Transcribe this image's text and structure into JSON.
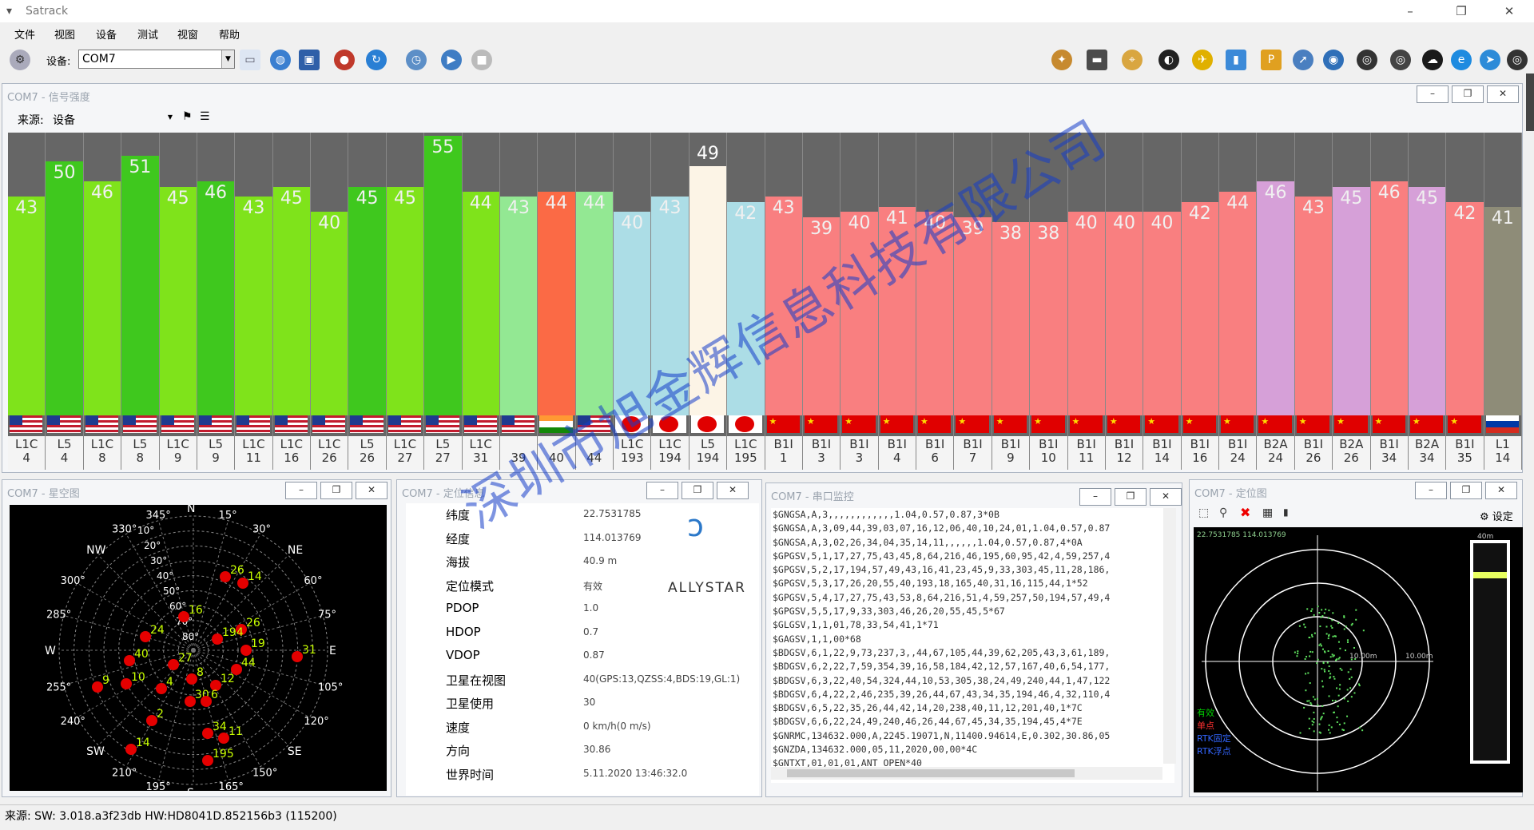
{
  "app": {
    "title": "Satrack",
    "min_label": "–",
    "max_label": "❐",
    "close_label": "✕"
  },
  "menu": [
    "文件",
    "视图",
    "设备",
    "测试",
    "视窗",
    "帮助"
  ],
  "toolbar": {
    "device_label": "设备:",
    "device_value": "COM7"
  },
  "signal_window": {
    "title": "COM7 - 信号强度",
    "source_label": "来源:",
    "source_value": "设备"
  },
  "signal_bars": [
    {
      "cn0": 43,
      "label": "L1C",
      "prn": "4",
      "flag": "us",
      "color": "#7fe31b"
    },
    {
      "cn0": 50,
      "label": "L5",
      "prn": "4",
      "flag": "us",
      "color": "#3fc81e"
    },
    {
      "cn0": 46,
      "label": "L1C",
      "prn": "8",
      "flag": "us",
      "color": "#7fe31b"
    },
    {
      "cn0": 51,
      "label": "L5",
      "prn": "8",
      "flag": "us",
      "color": "#3fc81e"
    },
    {
      "cn0": 45,
      "label": "L1C",
      "prn": "9",
      "flag": "us",
      "color": "#7fe31b"
    },
    {
      "cn0": 46,
      "label": "L5",
      "prn": "9",
      "flag": "us",
      "color": "#3fc81e"
    },
    {
      "cn0": 43,
      "label": "L1C",
      "prn": "11",
      "flag": "us",
      "color": "#7fe31b"
    },
    {
      "cn0": 45,
      "label": "L1C",
      "prn": "16",
      "flag": "us",
      "color": "#7fe31b"
    },
    {
      "cn0": 40,
      "label": "L1C",
      "prn": "26",
      "flag": "us",
      "color": "#7fe31b"
    },
    {
      "cn0": 45,
      "label": "L5",
      "prn": "26",
      "flag": "us",
      "color": "#3fc81e"
    },
    {
      "cn0": 45,
      "label": "L1C",
      "prn": "27",
      "flag": "us",
      "color": "#7fe31b"
    },
    {
      "cn0": 55,
      "label": "L5",
      "prn": "27",
      "flag": "us",
      "color": "#3fc81e"
    },
    {
      "cn0": 44,
      "label": "L1C",
      "prn": "31",
      "flag": "us",
      "color": "#7fe31b"
    },
    {
      "cn0": 43,
      "label": "",
      "prn": "39",
      "flag": "us",
      "color": "#93e893"
    },
    {
      "cn0": 44,
      "label": "",
      "prn": "40",
      "flag": "in",
      "color": "#fb6a45"
    },
    {
      "cn0": 44,
      "label": "",
      "prn": "44",
      "flag": "us",
      "color": "#93e893"
    },
    {
      "cn0": 40,
      "label": "L1C",
      "prn": "193",
      "flag": "jp",
      "color": "#acdde6"
    },
    {
      "cn0": 43,
      "label": "L1C",
      "prn": "194",
      "flag": "jp",
      "color": "#acdde6"
    },
    {
      "cn0": 49,
      "label": "L5",
      "prn": "194",
      "flag": "jp",
      "color": "#fcf4e6"
    },
    {
      "cn0": 42,
      "label": "L1C",
      "prn": "195",
      "flag": "jp",
      "color": "#acdde6"
    },
    {
      "cn0": 43,
      "label": "B1I",
      "prn": "1",
      "flag": "cn",
      "color": "#f97f80"
    },
    {
      "cn0": 39,
      "label": "B1I",
      "prn": "3",
      "flag": "cn",
      "color": "#f97f80"
    },
    {
      "cn0": 40,
      "label": "B1I",
      "prn": "3",
      "flag": "cn",
      "color": "#f97f80"
    },
    {
      "cn0": 41,
      "label": "B1I",
      "prn": "4",
      "flag": "cn",
      "color": "#f97f80"
    },
    {
      "cn0": 40,
      "label": "B1I",
      "prn": "6",
      "flag": "cn",
      "color": "#f97f80"
    },
    {
      "cn0": 39,
      "label": "B1I",
      "prn": "7",
      "flag": "cn",
      "color": "#f97f80"
    },
    {
      "cn0": 38,
      "label": "B1I",
      "prn": "9",
      "flag": "cn",
      "color": "#f97f80"
    },
    {
      "cn0": 38,
      "label": "B1I",
      "prn": "10",
      "flag": "cn",
      "color": "#f97f80"
    },
    {
      "cn0": 40,
      "label": "B1I",
      "prn": "11",
      "flag": "cn",
      "color": "#f97f80"
    },
    {
      "cn0": 40,
      "label": "B1I",
      "prn": "12",
      "flag": "cn",
      "color": "#f97f80"
    },
    {
      "cn0": 40,
      "label": "B1I",
      "prn": "14",
      "flag": "cn",
      "color": "#f97f80"
    },
    {
      "cn0": 42,
      "label": "B1I",
      "prn": "16",
      "flag": "cn",
      "color": "#f97f80"
    },
    {
      "cn0": 44,
      "label": "B1I",
      "prn": "24",
      "flag": "cn",
      "color": "#f97f80"
    },
    {
      "cn0": 46,
      "label": "B2A",
      "prn": "24",
      "flag": "cn",
      "color": "#d6a0d8"
    },
    {
      "cn0": 43,
      "label": "B1I",
      "prn": "26",
      "flag": "cn",
      "color": "#f97f80"
    },
    {
      "cn0": 45,
      "label": "B2A",
      "prn": "26",
      "flag": "cn",
      "color": "#d6a0d8"
    },
    {
      "cn0": 46,
      "label": "B1I",
      "prn": "34",
      "flag": "cn",
      "color": "#f97f80"
    },
    {
      "cn0": 45,
      "label": "B2A",
      "prn": "34",
      "flag": "cn",
      "color": "#d6a0d8"
    },
    {
      "cn0": 42,
      "label": "B1I",
      "prn": "35",
      "flag": "cn",
      "color": "#f97f80"
    },
    {
      "cn0": 41,
      "label": "L1",
      "prn": "14",
      "flag": "ru",
      "color": "#8e8c78"
    }
  ],
  "sky_window": {
    "title": "COM7 - 星空图",
    "directions": [
      "N",
      "NE",
      "E",
      "SE",
      "S",
      "SW",
      "W",
      "NW"
    ],
    "azimuths": [
      "15°",
      "30°",
      "60°",
      "75°",
      "105°",
      "120°",
      "150°",
      "165°",
      "195°",
      "210°",
      "240°",
      "255°",
      "285°",
      "300°",
      "330°",
      "345°"
    ],
    "elevations": [
      "10°",
      "20°",
      "30°",
      "40°",
      "50°",
      "60°",
      "70°",
      "80°"
    ],
    "sats": [
      "26",
      "14",
      "16",
      "26",
      "194",
      "19",
      "44",
      "31",
      "4",
      "40",
      "10",
      "9",
      "24",
      "27",
      "8",
      "12",
      "30",
      "6",
      "2",
      "34",
      "11",
      "14",
      "195"
    ]
  },
  "pos_window": {
    "title": "COM7 - 定位信息",
    "brand": "ALLYSTAR",
    "rows": [
      {
        "label": "纬度",
        "value": "22.7531785"
      },
      {
        "label": "经度",
        "value": "114.013769"
      },
      {
        "label": "海拔",
        "value": "40.9 m"
      },
      {
        "label": "定位模式",
        "value": "有效"
      },
      {
        "label": "PDOP",
        "value": "1.0"
      },
      {
        "label": "HDOP",
        "value": "0.7"
      },
      {
        "label": "VDOP",
        "value": "0.87"
      },
      {
        "label": "卫星在视图",
        "value": "40(GPS:13,QZSS:4,BDS:19,GL:1)"
      },
      {
        "label": "卫星使用",
        "value": "30"
      },
      {
        "label": "速度",
        "value": "0 km/h(0 m/s)"
      },
      {
        "label": "方向",
        "value": "30.86"
      },
      {
        "label": "世界时间",
        "value": "5.11.2020 13:46:32.0"
      }
    ]
  },
  "serial_window": {
    "title": "COM7 - 串口监控",
    "lines": [
      "$GNGSA,A,3,,,,,,,,,,,,1.04,0.57,0.87,3*0B",
      "$GNGSA,A,3,09,44,39,03,07,16,12,06,40,10,24,01,1.04,0.57,0.87",
      "$GNGSA,A,3,02,26,34,04,35,14,11,,,,,,1.04,0.57,0.87,4*0A",
      "$GPGSV,5,1,17,27,75,43,45,8,64,216,46,195,60,95,42,4,59,257,4",
      "$GPGSV,5,2,17,194,57,49,43,16,41,23,45,9,33,303,45,11,28,186,",
      "$GPGSV,5,3,17,26,20,55,40,193,18,165,40,31,16,115,44,1*52",
      "$GPGSV,5,4,17,27,75,43,53,8,64,216,51,4,59,257,50,194,57,49,4",
      "$GPGSV,5,5,17,9,33,303,46,26,20,55,45,5*67",
      "$GLGSV,1,1,01,78,33,54,41,1*71",
      "$GAGSV,1,1,00*68",
      "$BDGSV,6,1,22,9,73,237,3,,44,67,105,44,39,62,205,43,3,61,189,",
      "$BDGSV,6,2,22,7,59,354,39,16,58,184,42,12,57,167,40,6,54,177,",
      "$BDGSV,6,3,22,40,54,324,44,10,53,305,38,24,49,240,44,1,47,122",
      "$BDGSV,6,4,22,2,46,235,39,26,44,67,43,34,35,194,46,4,32,110,4",
      "$BDGSV,6,5,22,35,26,44,42,14,20,238,40,11,12,201,40,1*7C",
      "$BDGSV,6,6,22,24,49,240,46,26,44,67,45,34,35,194,45,4*7E",
      "$GNRMC,134632.000,A,2245.19071,N,11400.94614,E,0.302,30.86,05",
      "$GNZDA,134632.000,05,11,2020,00,00*4C",
      "$GNTXT,01,01,01,ANT_OPEN*40"
    ]
  },
  "map_window": {
    "title": "COM7 - 定位图",
    "settings_label": "设定",
    "scale_labels": [
      "40m",
      "10.00m",
      "10.00m"
    ],
    "coord_text": "22.7531785 114.013769",
    "legend": [
      "有效",
      "单点",
      "RTK固定",
      "RTK浮点"
    ],
    "legend_colors": [
      "#00d000",
      "#ff3030",
      "#3366ff",
      "#3366ff"
    ]
  },
  "status": {
    "text": "来源: SW: 3.018.a3f23db  HW:HD8041D.852156b3  (115200)"
  },
  "watermark": "深圳市旭金辉信息科技有限公司"
}
